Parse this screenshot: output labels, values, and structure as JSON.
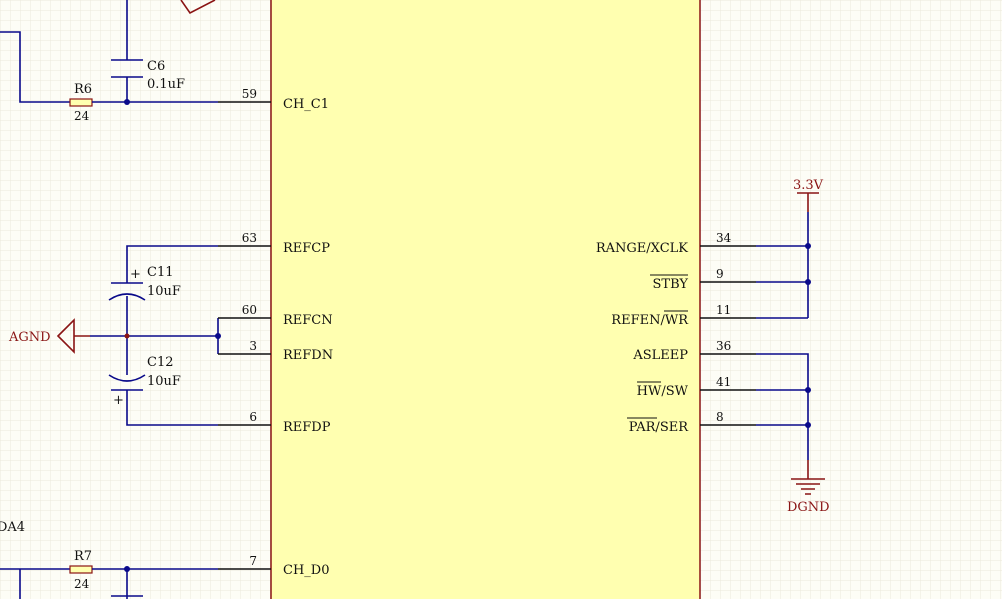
{
  "ic": {
    "left_pins": [
      {
        "number": "59",
        "name": "CH_C1"
      },
      {
        "number": "63",
        "name": "REFCP"
      },
      {
        "number": "60",
        "name": "REFCN"
      },
      {
        "number": "3",
        "name": "REFDN"
      },
      {
        "number": "6",
        "name": "REFDP"
      },
      {
        "number": "7",
        "name": "CH_D0"
      }
    ],
    "right_pins": [
      {
        "number": "34",
        "name": "RANGE/XCLK"
      },
      {
        "number": "9",
        "name": "STBY"
      },
      {
        "number": "11",
        "name": "REFEN/WR"
      },
      {
        "number": "36",
        "name": "ASLEEP"
      },
      {
        "number": "41",
        "name": "HW/SW"
      },
      {
        "number": "8",
        "name": "PAR/SER"
      }
    ]
  },
  "components": {
    "c6": {
      "designator": "C6",
      "value": "0.1uF"
    },
    "r6": {
      "designator": "R6",
      "value": "24"
    },
    "c11": {
      "designator": "C11",
      "value": "10uF",
      "polarity": "+"
    },
    "c12": {
      "designator": "C12",
      "value": "10uF",
      "polarity": "+"
    },
    "r7": {
      "designator": "R7",
      "value": "24"
    }
  },
  "power": {
    "agnd": "AGND",
    "v33": "3.3V",
    "dgnd": "DGND"
  },
  "net_fragment": "DA4",
  "colors": {
    "wire": "#0a0a8a",
    "power": "#8a1414",
    "ic_fill": "#ffffb0",
    "ic_border": "#8a1414",
    "background": "#fdfdf6",
    "grid": "#ece9dc"
  }
}
